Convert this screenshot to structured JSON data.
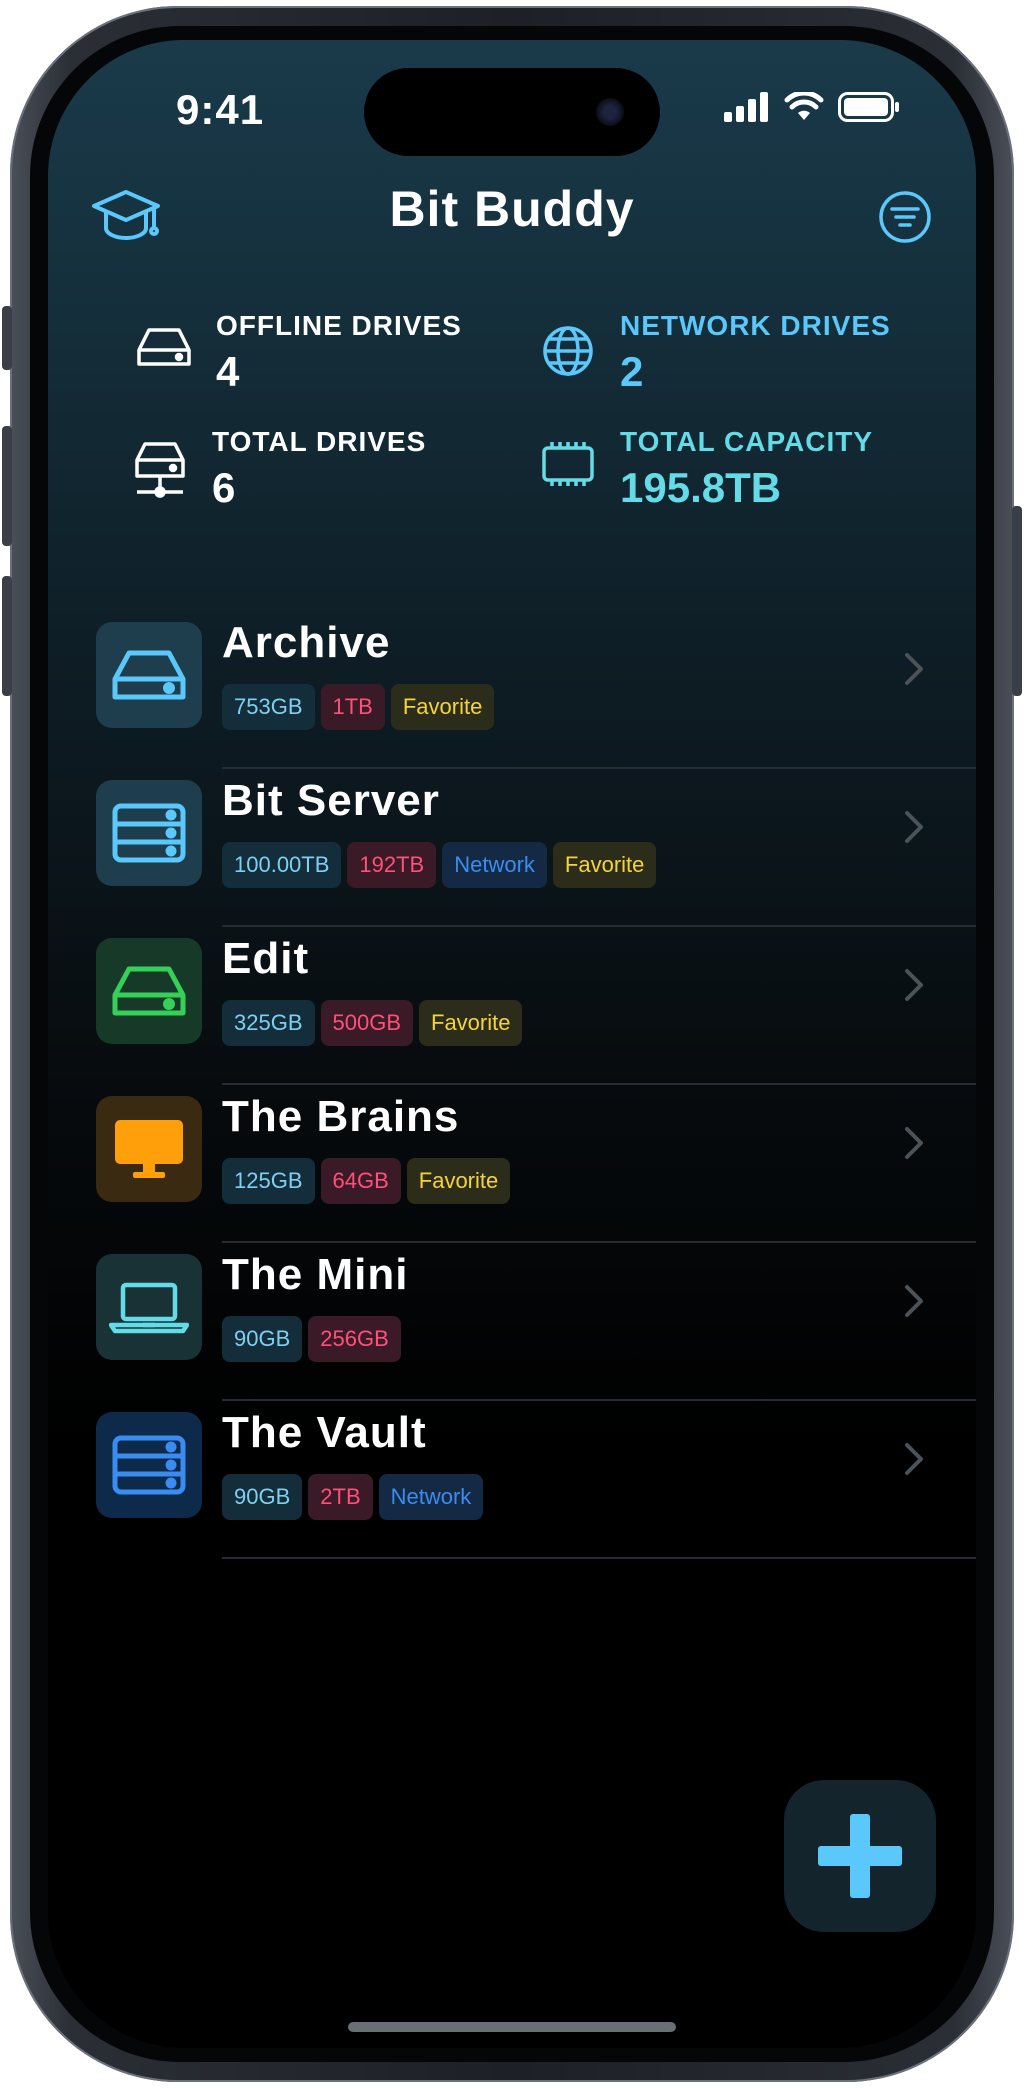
{
  "status": {
    "time": "9:41"
  },
  "header": {
    "title": "Bit Buddy",
    "left_icon": "graduation-cap-icon",
    "right_icon": "filter-icon"
  },
  "stats": {
    "offline": {
      "label": "OFFLINE DRIVES",
      "value": "4"
    },
    "network": {
      "label": "NETWORK DRIVES",
      "value": "2"
    },
    "total": {
      "label": "TOTAL DRIVES",
      "value": "6"
    },
    "capacity": {
      "label": "TOTAL CAPACITY",
      "value": "195.8TB"
    }
  },
  "drives": [
    {
      "name": "Archive",
      "icon": "hard-drive-icon",
      "icon_color": "#5ac8fa",
      "icon_bg": "#1e3d4d",
      "used": "753GB",
      "capacity": "1TB",
      "network": "",
      "favorite": "Favorite"
    },
    {
      "name": "Bit Server",
      "icon": "server-icon",
      "icon_color": "#5ac8fa",
      "icon_bg": "#1e3d4d",
      "used": "100.00TB",
      "capacity": "192TB",
      "network": "Network",
      "favorite": "Favorite"
    },
    {
      "name": "Edit",
      "icon": "hard-drive-icon",
      "icon_color": "#34d058",
      "icon_bg": "#173a28",
      "used": "325GB",
      "capacity": "500GB",
      "network": "",
      "favorite": "Favorite"
    },
    {
      "name": "The Brains",
      "icon": "desktop-icon",
      "icon_color": "#ff9f0a",
      "icon_bg": "#3a2a12",
      "used": "125GB",
      "capacity": "64GB",
      "network": "",
      "favorite": "Favorite"
    },
    {
      "name": "The Mini",
      "icon": "laptop-icon",
      "icon_color": "#64dce8",
      "icon_bg": "#183236",
      "used": "90GB",
      "capacity": "256GB",
      "network": "",
      "favorite": ""
    },
    {
      "name": "The Vault",
      "icon": "server-icon",
      "icon_color": "#3a8cf0",
      "icon_bg": "#0e2a4a",
      "used": "90GB",
      "capacity": "2TB",
      "network": "Network",
      "favorite": ""
    }
  ],
  "fab": {
    "icon": "plus-icon",
    "color": "#5ac8fa"
  }
}
